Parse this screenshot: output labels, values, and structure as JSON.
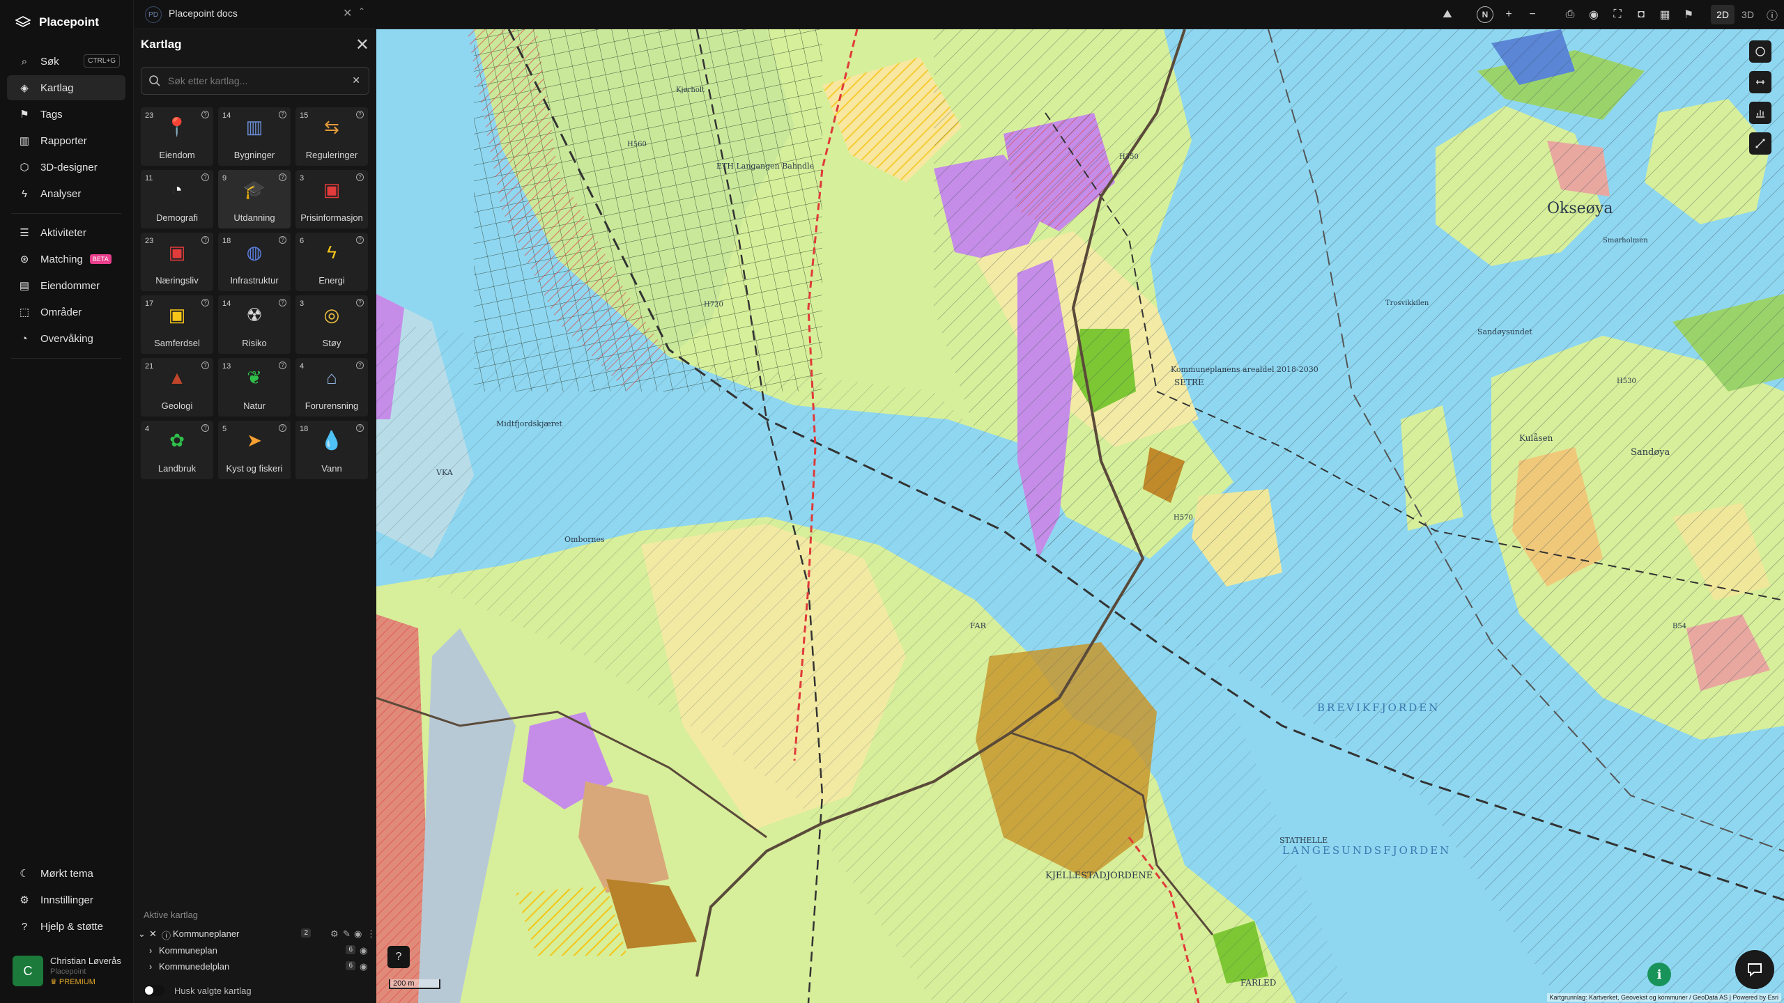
{
  "app": {
    "name": "Placepoint"
  },
  "workspace": {
    "badge": "PD",
    "name": "Placepoint docs"
  },
  "nav": {
    "main": [
      {
        "label": "Søk",
        "icon": "search-icon",
        "shortcut": "CTRL+G"
      },
      {
        "label": "Kartlag",
        "icon": "layers-icon",
        "active": true
      },
      {
        "label": "Tags",
        "icon": "bookmark-icon"
      },
      {
        "label": "Rapporter",
        "icon": "chart-icon"
      },
      {
        "label": "3D-designer",
        "icon": "cube-icon"
      },
      {
        "label": "Analyser",
        "icon": "lightning-icon"
      }
    ],
    "secondary": [
      {
        "label": "Aktiviteter",
        "icon": "activity-icon"
      },
      {
        "label": "Matching",
        "icon": "matching-icon",
        "badge": "BETA"
      },
      {
        "label": "Eiendommer",
        "icon": "building-list-icon"
      },
      {
        "label": "Områder",
        "icon": "area-icon"
      },
      {
        "label": "Overvåking",
        "icon": "monitor-icon"
      }
    ],
    "bottom": [
      {
        "label": "Mørkt tema",
        "icon": "moon-icon"
      },
      {
        "label": "Innstillinger",
        "icon": "gear-icon"
      },
      {
        "label": "Hjelp & støtte",
        "icon": "help-icon"
      }
    ]
  },
  "user": {
    "initial": "C",
    "name": "Christian Løverås",
    "org": "Placepoint",
    "plan": "PREMIUM"
  },
  "panel": {
    "title": "Kartlag",
    "search_placeholder": "Søk etter kartlag...",
    "tiles": [
      {
        "count": "23",
        "label": "Eiendom",
        "icon": "property-pin-icon"
      },
      {
        "count": "14",
        "label": "Bygninger",
        "icon": "buildings-icon"
      },
      {
        "count": "15",
        "label": "Reguleringer",
        "icon": "signpost-icon"
      },
      {
        "count": "11",
        "label": "Demografi",
        "icon": "demography-icon"
      },
      {
        "count": "9",
        "label": "Utdanning",
        "icon": "graduation-cap-icon",
        "active": true
      },
      {
        "count": "3",
        "label": "Prisinformasjon",
        "icon": "price-bag-icon"
      },
      {
        "count": "23",
        "label": "Næringsliv",
        "icon": "business-bag-icon"
      },
      {
        "count": "18",
        "label": "Infrastruktur",
        "icon": "infrastructure-globe-icon"
      },
      {
        "count": "6",
        "label": "Energi",
        "icon": "lightning-energy-icon"
      },
      {
        "count": "17",
        "label": "Samferdsel",
        "icon": "train-icon"
      },
      {
        "count": "14",
        "label": "Risiko",
        "icon": "risk-icon"
      },
      {
        "count": "3",
        "label": "Støy",
        "icon": "noise-icon"
      },
      {
        "count": "21",
        "label": "Geologi",
        "icon": "geology-icon"
      },
      {
        "count": "13",
        "label": "Natur",
        "icon": "leaf-icon"
      },
      {
        "count": "4",
        "label": "Forurensning",
        "icon": "factory-icon"
      },
      {
        "count": "4",
        "label": "Landbruk",
        "icon": "sprout-icon"
      },
      {
        "count": "5",
        "label": "Kyst og fiskeri",
        "icon": "fish-icon"
      },
      {
        "count": "18",
        "label": "Vann",
        "icon": "water-drop-icon"
      }
    ],
    "active_title": "Aktive kartlag",
    "active_group": {
      "label": "Kommuneplaner",
      "count": "2"
    },
    "active_layers": [
      {
        "label": "Kommuneplan",
        "count": "6"
      },
      {
        "label": "Kommunedelplan",
        "count": "6"
      }
    ],
    "remember_label": "Husk valgte kartlag"
  },
  "toolbar": {
    "mode_2d": "2D",
    "mode_3d": "3D",
    "compass": "N"
  },
  "map": {
    "scale": "200 m",
    "attribution": "Kartgrunnlag: Kartverket, Geovekst og kommuner / GeoData AS | Powered by Esri",
    "labels": [
      "Okseøya",
      "Sandøya",
      "Kulåsen",
      "LANGESUNDSFJORDEN",
      "BREVIKFJORDEN",
      "STATHELLE",
      "FARLED",
      "Midtfjordskjæret",
      "VKA",
      "Ombornes",
      "Kommuneplanens arealdel 2018-2030",
      "KJELLESTADJORDENE",
      "SETRE",
      "Sandøysundet",
      "Trosvikkilen",
      "Smørholmen",
      "ETH Langangen Bahndle",
      "Kjørholt",
      "H560",
      "H720",
      "H350",
      "H530",
      "H570",
      "B54",
      "FAR"
    ]
  }
}
